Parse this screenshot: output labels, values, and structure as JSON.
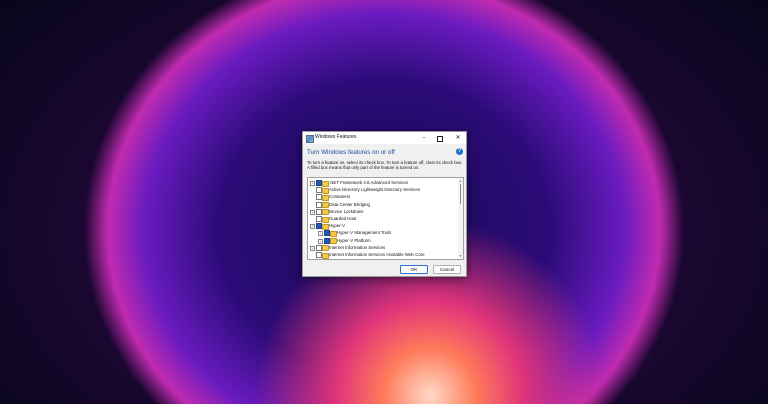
{
  "window": {
    "title": "Windows Features",
    "minimize_glyph": "–",
    "close_glyph": "✕",
    "heading": "Turn Windows features on or off",
    "help_glyph": "?",
    "description": "To turn a feature on, select its check box. To turn a feature off, clear its check box. A filled box means that only part of the feature is turned on."
  },
  "features": [
    {
      "label": ".NET Framework 4.8 Advanced Services",
      "indent": 0,
      "expandable": true,
      "state": "partial"
    },
    {
      "label": "Active Directory Lightweight Directory Services",
      "indent": 0,
      "expandable": false,
      "state": "off"
    },
    {
      "label": "Containers",
      "indent": 0,
      "expandable": false,
      "state": "off"
    },
    {
      "label": "Data Center Bridging",
      "indent": 0,
      "expandable": false,
      "state": "off"
    },
    {
      "label": "Device Lockdown",
      "indent": 0,
      "expandable": true,
      "state": "off"
    },
    {
      "label": "Guarded Host",
      "indent": 0,
      "expandable": false,
      "state": "off"
    },
    {
      "label": "Hyper-V",
      "indent": 0,
      "expandable": true,
      "state": "full"
    },
    {
      "label": "Hyper-V Management Tools",
      "indent": 1,
      "expandable": true,
      "state": "full"
    },
    {
      "label": "Hyper-V Platform",
      "indent": 1,
      "expandable": true,
      "state": "full"
    },
    {
      "label": "Internet Information Services",
      "indent": 0,
      "expandable": true,
      "state": "off"
    },
    {
      "label": "Internet Information Services Hostable Web Core",
      "indent": 0,
      "expandable": false,
      "state": "off"
    },
    {
      "label": "Legacy Components",
      "indent": 0,
      "expandable": true,
      "state": "off"
    }
  ],
  "expander_glyph": "+",
  "buttons": {
    "ok": "OK",
    "cancel": "Cancel"
  },
  "colors": {
    "heading": "#1e4a9e",
    "checkbox_fill": "#2458b8",
    "folder": "#f2c94c"
  }
}
